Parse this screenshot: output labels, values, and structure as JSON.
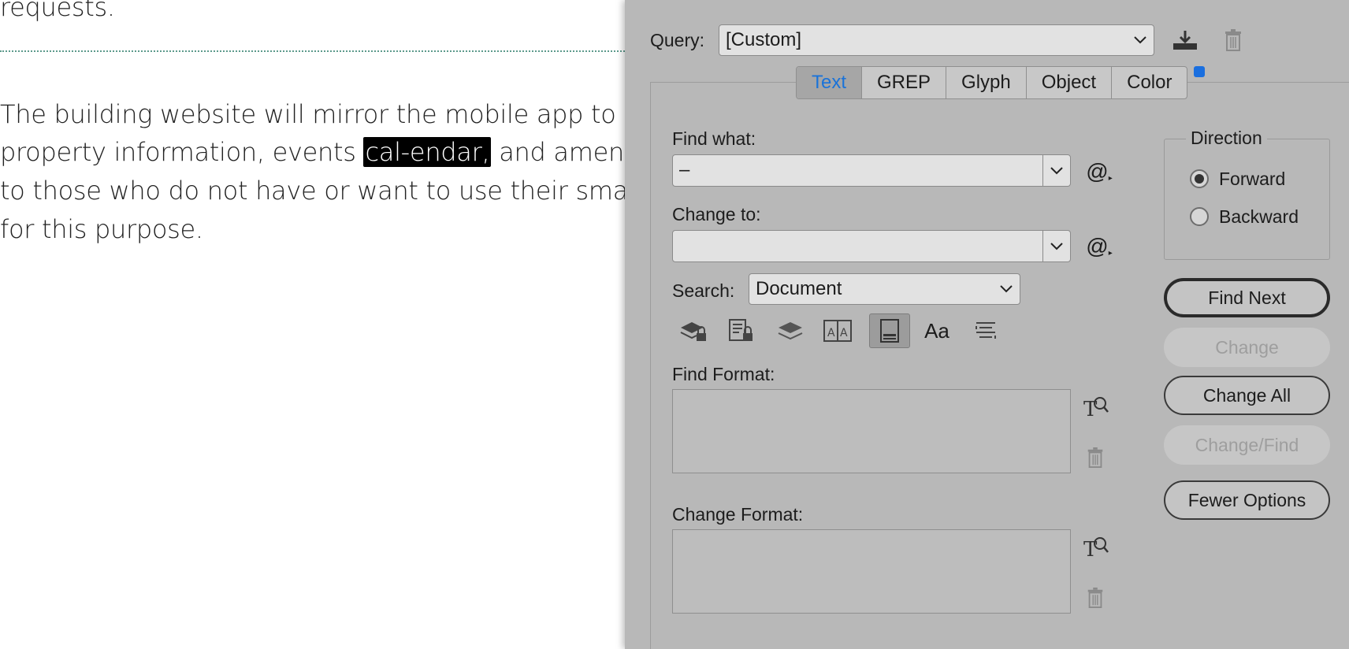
{
  "document": {
    "lines": [
      "requests.",
      "The building website will mirror the mobile app to pro",
      "property information, events ",
      " and amenity a",
      "to those who do not have or want to use their smartp",
      "for this purpose."
    ],
    "selected_word": "cal-endar,"
  },
  "dialog": {
    "query_label": "Query:",
    "query_value": "[Custom]",
    "tabs": [
      "Text",
      "GREP",
      "Glyph",
      "Object",
      "Color"
    ],
    "active_tab": "Text",
    "find_what_label": "Find what:",
    "find_what_value": "–",
    "change_to_label": "Change to:",
    "change_to_value": "",
    "search_label": "Search:",
    "search_value": "Document",
    "find_format_label": "Find Format:",
    "change_format_label": "Change Format:",
    "direction": {
      "title": "Direction",
      "forward": "Forward",
      "backward": "Backward",
      "selected": "Forward"
    },
    "buttons": {
      "find_next": "Find Next",
      "change": "Change",
      "change_all": "Change All",
      "change_find": "Change/Find",
      "fewer_options": "Fewer Options"
    },
    "special_char_symbol": "@",
    "case_sensitive_symbol": "Aa",
    "colors": {
      "accent": "#1a73d9",
      "panel": "#b8b8b8",
      "selection_bg": "#000000"
    }
  }
}
